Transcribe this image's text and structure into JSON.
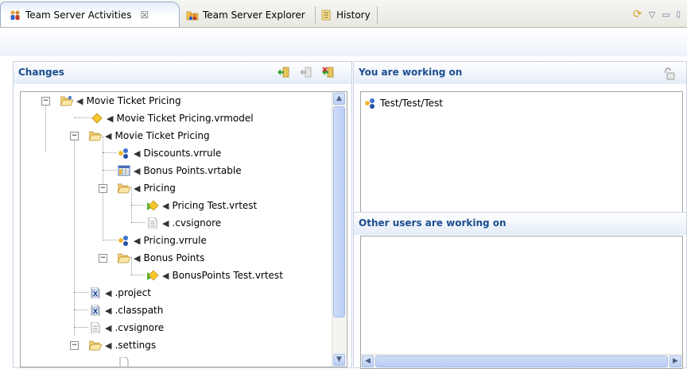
{
  "tabs": [
    {
      "label": "Team Server Activities",
      "icon": "team-server-activities-icon"
    },
    {
      "label": "Team Server Explorer",
      "icon": "team-server-explorer-icon"
    },
    {
      "label": "History",
      "icon": "history-icon"
    }
  ],
  "changes": {
    "title": "Changes",
    "tree": [
      {
        "label": "Movie Ticket Pricing",
        "icon": "open-folder-icon"
      },
      {
        "label": "Movie Ticket Pricing.vrmodel",
        "icon": "vrmodel-diamond-icon"
      },
      {
        "label": "Movie Ticket Pricing",
        "icon": "open-folder-icon"
      },
      {
        "label": "Discounts.vrrule",
        "icon": "vrrule-icon"
      },
      {
        "label": "Bonus Points.vrtable",
        "icon": "vrtable-icon"
      },
      {
        "label": "Pricing",
        "icon": "open-folder-icon"
      },
      {
        "label": "Pricing Test.vrtest",
        "icon": "vrtest-icon"
      },
      {
        "label": ".cvsignore",
        "icon": "text-file-icon"
      },
      {
        "label": "Pricing.vrrule",
        "icon": "vrrule-icon"
      },
      {
        "label": "Bonus Points",
        "icon": "open-folder-icon"
      },
      {
        "label": "BonusPoints Test.vrtest",
        "icon": "vrtest-icon"
      },
      {
        "label": ".project",
        "icon": "xml-file-icon"
      },
      {
        "label": ".classpath",
        "icon": "xml-file-icon"
      },
      {
        "label": ".cvsignore",
        "icon": "text-file-icon"
      },
      {
        "label": ".settings",
        "icon": "open-folder-icon"
      }
    ]
  },
  "working_on": {
    "title": "You are working on",
    "items": [
      {
        "label": "Test/Test/Test",
        "icon": "user-group-icon"
      }
    ]
  },
  "others": {
    "title": "Other users are working on",
    "items": []
  },
  "colors": {
    "section_title": "#1a4d8f",
    "active_tab_border": "#97acd0"
  }
}
